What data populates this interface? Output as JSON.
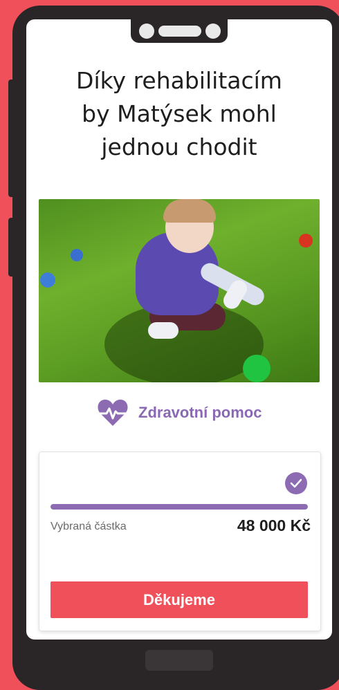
{
  "title": "Díky rehabilitacím\nby Matýsek mohl\njednou chodit",
  "category": {
    "label": "Zdravotní pomoc",
    "icon": "heartbeat-icon",
    "color": "#8c6bb3"
  },
  "collected": {
    "label": "Vybraná částka",
    "amount": "48 000 Kč",
    "progress_percent": 100,
    "status_icon": "check-circle-icon"
  },
  "cta": {
    "label": "Děkujeme",
    "color": "#f0505a"
  },
  "colors": {
    "background": "#f0505a",
    "phone": "#2a2627",
    "accent": "#8c6bb3"
  }
}
